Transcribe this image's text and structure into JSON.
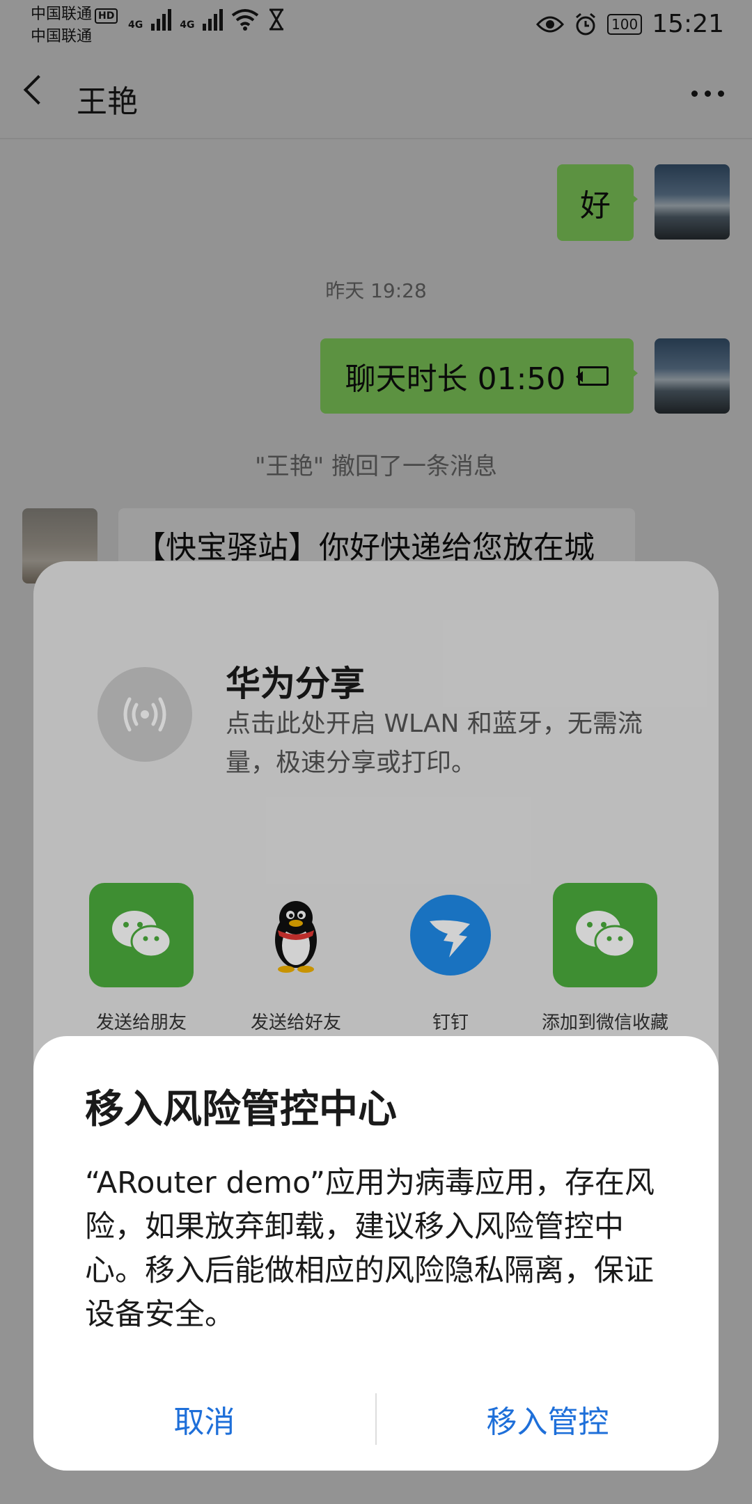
{
  "status_bar": {
    "carrier1": "中国联通",
    "carrier2": "中国联通",
    "hd": "HD",
    "net1": "4G",
    "net2": "4G",
    "battery": "100",
    "time": "15:21"
  },
  "chat": {
    "title": "王艳",
    "messages": {
      "reply_text": "好",
      "timestamp": "昨天 19:28",
      "call_text": "聊天时长 01:50",
      "recall_notice": "\"王艳\" 撤回了一条消息",
      "incoming_text": "【快宝驿站】你好快递给您放在城"
    }
  },
  "share_sheet": {
    "huawei_share_title": "华为分享",
    "huawei_share_desc": "点击此处开启 WLAN 和蓝牙，无需流量，极速分享或打印。",
    "apps": [
      {
        "label": "发送给朋友",
        "icon": "wechat-icon"
      },
      {
        "label": "发送给好友",
        "icon": "qq-penguin-icon"
      },
      {
        "label": "钉钉",
        "icon": "dingtalk-icon"
      },
      {
        "label": "添加到微信收藏",
        "icon": "wechat-icon"
      }
    ]
  },
  "dialog": {
    "title": "移入风险管控中心",
    "body": "“ARouter demo”应用为病毒应用，存在风险，如果放弃卸载，建议移入风险管控中心。移入后能做相应的风险隐私隔离，保证设备安全。",
    "cancel_label": "取消",
    "confirm_label": "移入管控"
  },
  "colors": {
    "accent": "#1e6fd9",
    "wechat_green": "#4cae3e",
    "bubble_green": "#95ec69"
  }
}
